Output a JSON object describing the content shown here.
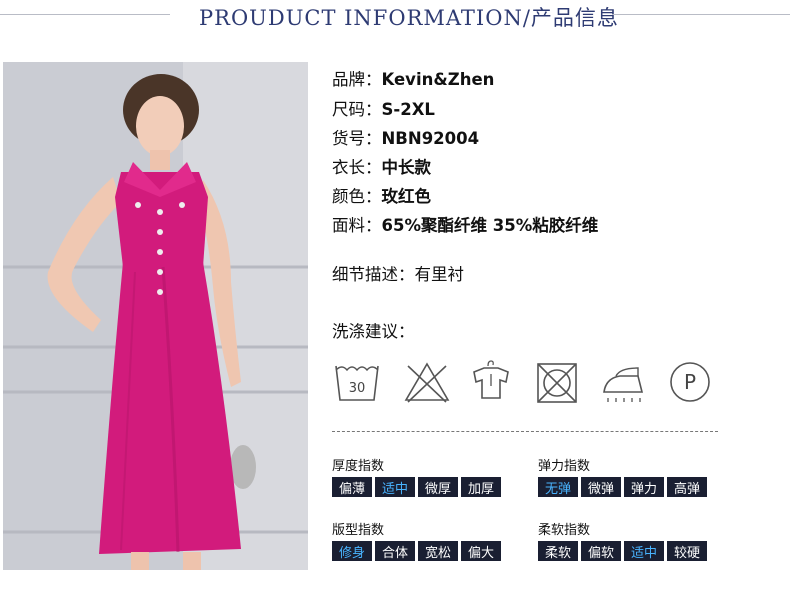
{
  "header": {
    "title": "PROUDUCT INFORMATION/产品信息"
  },
  "info": [
    {
      "key": "品牌：",
      "value": "Kevin&Zhen"
    },
    {
      "key": "尺码：",
      "value": "S-2XL"
    },
    {
      "key": "货号：",
      "value": "NBN92004"
    },
    {
      "key": "衣长：",
      "value": "中长款"
    },
    {
      "key": "颜色：",
      "value": "玫红色"
    },
    {
      "key": "面料：",
      "value": "65%聚酯纤维 35%粘胶纤维"
    }
  ],
  "detail": {
    "key": "细节描述：",
    "value": "有里衬"
  },
  "care": {
    "title": "洗涤建议：",
    "wash_temp": "30",
    "icons": [
      "wash-30-icon",
      "no-bleach-icon",
      "hang-dry-icon",
      "no-tumble-dry-icon",
      "iron-icon",
      "dry-clean-p-icon"
    ],
    "dryclean_letter": "P"
  },
  "indices": [
    {
      "label": "厚度指数",
      "options": [
        "偏薄",
        "适中",
        "微厚",
        "加厚"
      ],
      "selected": 1
    },
    {
      "label": "弹力指数",
      "options": [
        "无弹",
        "微弹",
        "弹力",
        "高弹"
      ],
      "selected": 0
    },
    {
      "label": "版型指数",
      "options": [
        "修身",
        "合体",
        "宽松",
        "偏大"
      ],
      "selected": 0
    },
    {
      "label": "柔软指数",
      "options": [
        "柔软",
        "偏软",
        "适中",
        "较硬"
      ],
      "selected": 2
    }
  ],
  "colors": {
    "accent": "#2e3b73",
    "tag_bg": "#1a1f32",
    "tag_selected_text": "#49b4ff",
    "dress": "#d21b7c"
  }
}
